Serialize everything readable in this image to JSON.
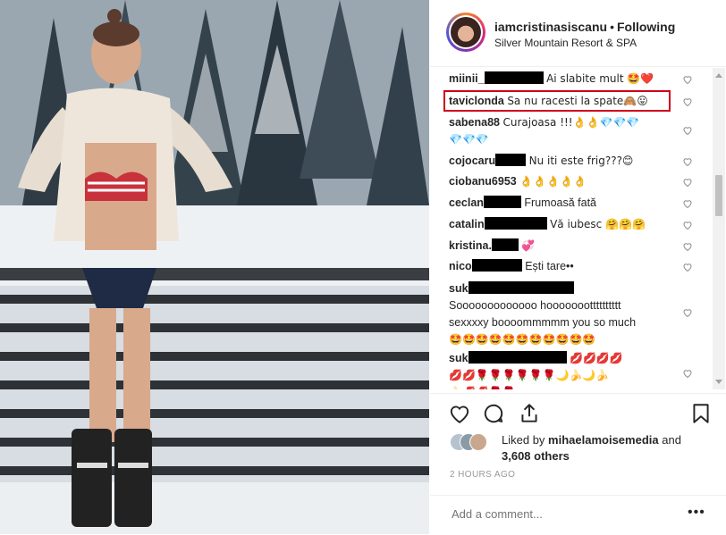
{
  "post": {
    "username": "iamcristinasiscanu",
    "separator": "•",
    "follow_label": "Following",
    "location": "Silver Mountain Resort & SPA"
  },
  "comments": [
    {
      "user": "miinii_",
      "redacted": true,
      "text": "Ai slabite mult 🤩❤️"
    },
    {
      "user": "taviclonda",
      "redacted": false,
      "text": "Sa nu racesti la spate🙈😛"
    },
    {
      "user": "sabena88",
      "redacted": false,
      "text": "Curajoasa !!!👌👌💎💎💎",
      "text2": "💎💎💎"
    },
    {
      "user": "cojocaru",
      "redacted": true,
      "text": "Nu iti este frig???😊"
    },
    {
      "user": "ciobanu6953",
      "redacted": false,
      "text": "👌👌👌👌👌"
    },
    {
      "user": "ceclan",
      "redacted": true,
      "text": "Frumoasă fată"
    },
    {
      "user": "catalin",
      "redacted": true,
      "text": "Vă iubesc 🤗🤗🤗"
    },
    {
      "user": "kristina.",
      "redacted": true,
      "text": "💞"
    },
    {
      "user": "nico",
      "redacted": true,
      "text": "Ești tare••"
    },
    {
      "user": "suk",
      "redacted": true,
      "text": "Sooooooooooooo hoooooootttttttttt",
      "text2": "sexxxxy boooommmmm you so much",
      "text3": "🤩🤩🤩🤩🤩🤩🤩🤩🤩🤩🤩"
    },
    {
      "user": "suk",
      "redacted": true,
      "text": "💋💋💋💋",
      "text2": "💋💋🌹🌹🌹🌹🌹🌹🌙🍌🌙🍌",
      "text3": "🍌💋💋🌹🌹"
    }
  ],
  "actions": {
    "like": "heart-outline-icon",
    "comment": "comment-bubble-icon",
    "share": "share-icon",
    "save": "bookmark-icon"
  },
  "likes": {
    "prefix": "Liked by",
    "liker": "mihaelamoisemedia",
    "joiner": "and",
    "others": "3,608 others"
  },
  "timestamp": "2 HOURS AGO",
  "composer": {
    "placeholder": "Add a comment...",
    "more": "•••"
  },
  "colors": {
    "highlight": "#d0021b",
    "text": "#262626",
    "muted": "#999999",
    "divider": "#efefef"
  }
}
